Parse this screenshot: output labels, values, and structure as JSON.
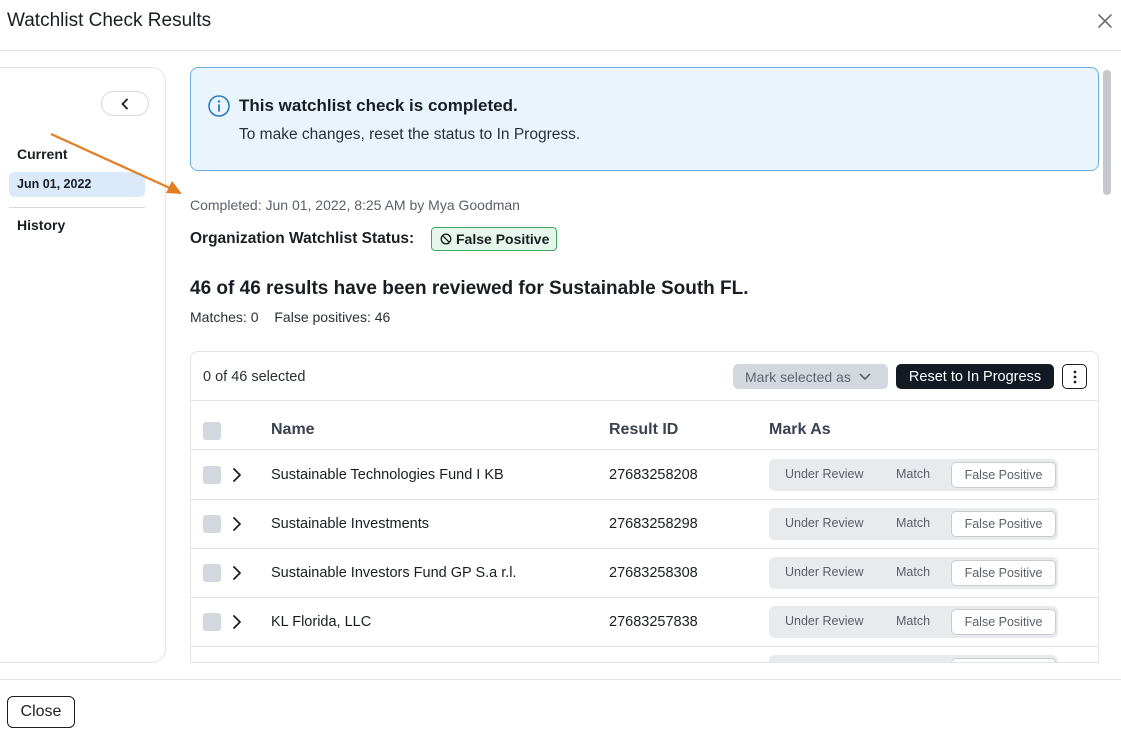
{
  "modal": {
    "title": "Watchlist Check Results",
    "close_icon": "close-icon"
  },
  "sidebar": {
    "collapse_icon": "chevron-left-icon",
    "current_heading": "Current",
    "current_date": "Jun 01, 2022",
    "history_heading": "History"
  },
  "alert": {
    "icon": "info-icon",
    "title": "This watchlist check is completed.",
    "body": "To make changes, reset the status to In Progress.",
    "accent_color": "#6aaee0"
  },
  "status": {
    "completed_text": "Completed: Jun 01, 2022, 8:25 AM by Mya Goodman",
    "org_label": "Organization Watchlist Status:",
    "badge_icon": "ban-icon",
    "badge_text": "False Positive",
    "badge_color": "#3ea95a"
  },
  "summary": {
    "headline": "46 of 46 results have been reviewed for Sustainable South FL.",
    "matches": "Matches: 0",
    "false_positives": "False positives: 46"
  },
  "toolbar": {
    "selected_count": "0 of 46 selected",
    "mark_selected_label": "Mark selected as",
    "reset_label": "Reset to In Progress",
    "more_icon": "kebab-menu-icon"
  },
  "table": {
    "columns": {
      "name": "Name",
      "result_id": "Result ID",
      "mark_as": "Mark As"
    },
    "mark_options": {
      "under_review": "Under Review",
      "match": "Match",
      "false_positive": "False Positive"
    },
    "rows": [
      {
        "name": "Sustainable Technologies Fund I KB",
        "result_id": "27683258208",
        "mark": "False Positive"
      },
      {
        "name": "Sustainable Investments",
        "result_id": "27683258298",
        "mark": "False Positive"
      },
      {
        "name": "Sustainable Investors Fund GP S.a r.l.",
        "result_id": "27683258308",
        "mark": "False Positive"
      },
      {
        "name": "KL Florida, LLC",
        "result_id": "27683257838",
        "mark": "False Positive"
      }
    ]
  },
  "footer": {
    "close_label": "Close"
  },
  "annotation": {
    "arrow_color": "#e27d23"
  }
}
